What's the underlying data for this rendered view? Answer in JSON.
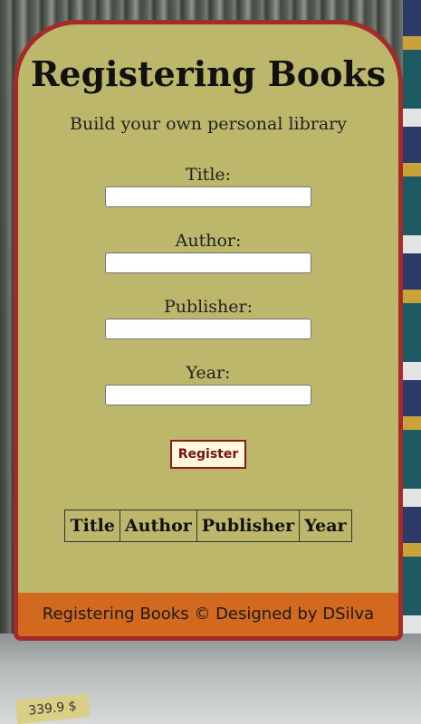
{
  "header": {
    "title": "Registering Books",
    "subtitle": "Build your own personal library"
  },
  "form": {
    "fields": [
      {
        "label": "Title:",
        "value": "",
        "placeholder": ""
      },
      {
        "label": "Author:",
        "value": "",
        "placeholder": ""
      },
      {
        "label": "Publisher:",
        "value": "",
        "placeholder": ""
      },
      {
        "label": "Year:",
        "value": "",
        "placeholder": ""
      }
    ],
    "submit_label": "Register"
  },
  "table": {
    "headers": [
      "Title",
      "Author",
      "Publisher",
      "Year"
    ]
  },
  "footer": {
    "text": "Registering Books © Designed by DSilva"
  },
  "background": {
    "price_label": "339.9 $"
  },
  "colors": {
    "card_background": "#bdb76b",
    "card_border": "#a52a2a",
    "footer_background": "#d2691e",
    "button_text": "#7a1010"
  }
}
